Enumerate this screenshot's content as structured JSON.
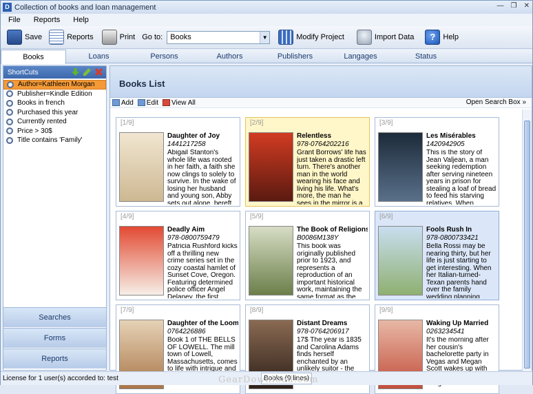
{
  "window": {
    "title": "Collection of books and loan management"
  },
  "menu": [
    "File",
    "Reports",
    "Help"
  ],
  "toolbar": {
    "save": "Save",
    "reports": "Reports",
    "print": "Print",
    "goto_label": "Go to:",
    "goto_value": "Books",
    "modify": "Modify Project",
    "import": "Import Data",
    "help": "Help"
  },
  "tabs": [
    "Books",
    "Loans",
    "Persons",
    "Authors",
    "Publishers",
    "Langages",
    "Status"
  ],
  "shortcuts": {
    "title": "ShortCuts",
    "items": [
      "Author=Kathleen Morgan",
      "Publisher=Kindle Edition",
      "Books in french",
      "Purchased this year",
      "Currently rented",
      "Price > 30$",
      "Title contains 'Family'"
    ]
  },
  "nav": {
    "searches": "Searches",
    "forms": "Forms",
    "reports": "Reports"
  },
  "main": {
    "title": "Books List",
    "add": "Add",
    "edit": "Edit",
    "view_all": "View All",
    "open_search": "Open Search Box"
  },
  "books": [
    {
      "num": "[1/9]",
      "title": "Daughter of Joy",
      "isbn": "1441217258",
      "desc": "Abigail Stanton's whole life was rooted in her faith, a faith she now clings to solely to survive. In the wake of losing her husband and young son, Abby sets out alone, bereft and heartsick, to di",
      "cover_color": "#d9c8a6"
    },
    {
      "num": "[2/9]",
      "title": "Relentless",
      "isbn": "978-0764202216",
      "desc": "Grant Borrows' life has just taken a drastic left turn. There's another man in the world wearing his face and living his life. What's more, the man he sees in the mirror is a stranger.",
      "cover_color": "#c0321e"
    },
    {
      "num": "[3/9]",
      "title": "Les Misérables",
      "isbn": "1420942905",
      "desc": "This is the story of Jean Valjean, a man seeking redemption after serving nineteen years in prison for stealing a loaf of bread to feed his starving relatives. When everyone else turns their back on hi",
      "cover_color": "#20303e"
    },
    {
      "num": "[4/9]",
      "title": "Deadly Aim",
      "isbn": "978-0800759479",
      "desc": "Patricia Rushford kicks off a thrilling new crime series set in the cozy coastal hamlet of Sunset Cove, Oregon. Featuring determined police officer Angel Delaney, the first episode is sure to have ar",
      "cover_color": "#cf3426"
    },
    {
      "num": "[5/9]",
      "title": "The Book of Religions..",
      "isbn": "B0086M138Y",
      "desc": "This book was originally published prior to 1923, and represents a reproduction of an important historical work, maintaining the same format as the original work. While some publish",
      "cover_color": "#6b7f4a"
    },
    {
      "num": "[6/9]",
      "title": "Fools Rush In",
      "isbn": "978-0800733421",
      "desc": "Bella Rossi may be nearing thirty, but her life is just starting to get interesting. When her Italian-turned-Texan parents hand over the family wedding planning business, Bella is determi",
      "cover_color": "#b9d3e8"
    },
    {
      "num": "[7/9]",
      "title": "Daughter of the Loom",
      "isbn": "0764226886",
      "desc": "Book 1 of THE BELLS OF LOWELL. The mill town of Lowell, Massachusetts, comes to life with intrigue and drama from the",
      "cover_color": "#c7a27a"
    },
    {
      "num": "[8/9]",
      "title": "Distant Dreams",
      "isbn": "978-0764206917",
      "desc": "17$ The year is 1835 and Carolina Adams finds herself enchanted by an unlikely suitor - the",
      "cover_color": "#4a3427"
    },
    {
      "num": "[9/9]",
      "title": "Waking Up Married",
      "isbn": "0263234541",
      "desc": "It's the morning after her cousin's bachelorette party in Vegas and Megan Scott wakes up with the mother of all hangovers",
      "cover_color": "#c24e3b"
    }
  ],
  "status": {
    "license": "License for 1 user(s) accorded to:  test",
    "count": "Books (9 lines)"
  },
  "watermark": "GearDownload.com"
}
